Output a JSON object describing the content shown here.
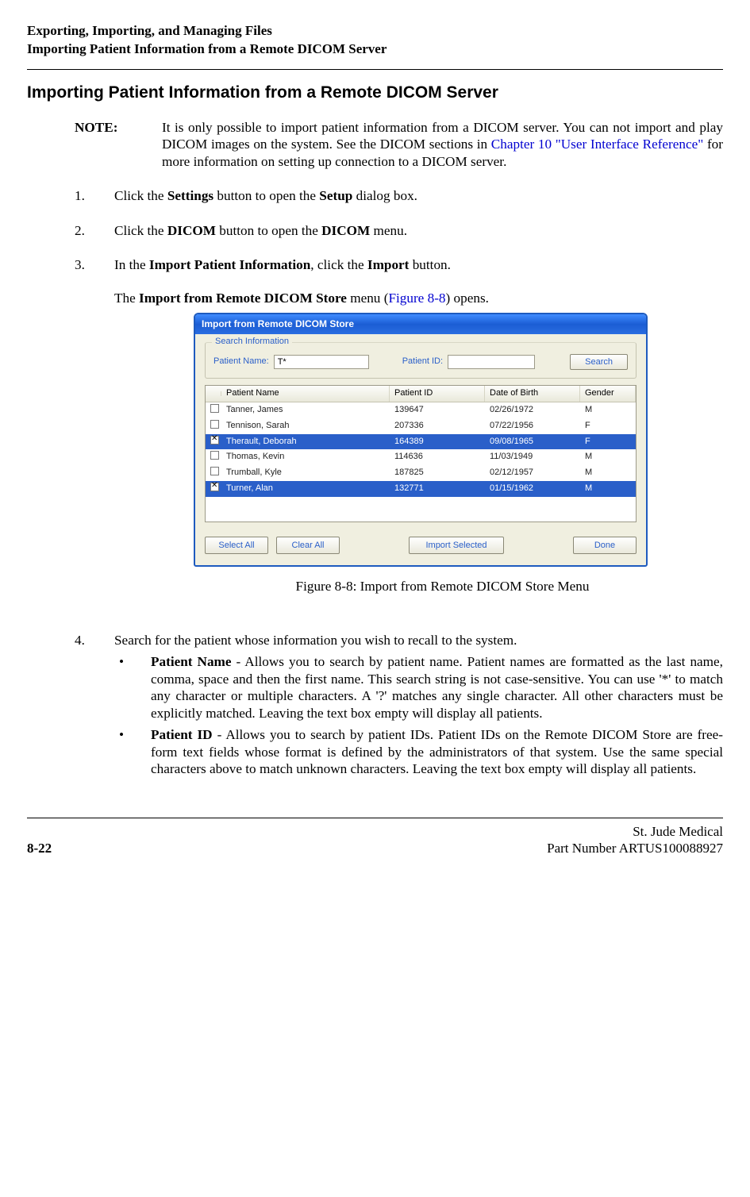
{
  "header": {
    "line1": "Exporting, Importing, and Managing Files",
    "line2": "Importing Patient Information from a Remote DICOM Server"
  },
  "section_title": "Importing Patient Information from a Remote DICOM Server",
  "note": {
    "label": "NOTE:",
    "text_before_link": "It is only possible to import patient information from a DICOM server. You can not import and play DICOM images on the system. See the DICOM sections in ",
    "link_text": "Chapter 10 \"User Interface Reference\"",
    "text_after_link": " for more infor­mation on setting up connection to a DICOM server."
  },
  "steps": {
    "s1": {
      "num": "1.",
      "a": "Click the ",
      "b": "Settings",
      "c": " button to open the ",
      "d": "Setup",
      "e": " dialog box."
    },
    "s2": {
      "num": "2.",
      "a": "Click the ",
      "b": "DICOM",
      "c": " button to open the ",
      "d": "DICOM",
      "e": " menu."
    },
    "s3": {
      "num": "3.",
      "a": "In the ",
      "b": "Import Patient Information",
      "c": ", click the ",
      "d": "Import",
      "e": " button.",
      "p2a": "The ",
      "p2b": "Import from Remote DICOM Store",
      "p2c": " menu (",
      "p2link": "Figure 8-8",
      "p2d": ") opens."
    },
    "s4": {
      "num": "4.",
      "text": "Search for the patient whose information you wish to recall to the system."
    }
  },
  "bullets": {
    "b1": {
      "lead": "Patient Name",
      "rest": " - Allows you to search by patient name. Patient names are for­matted as the last name, comma, space and then the first name. This search string is not case-sensitive. You can use '*' to match any character or multiple characters. A '?' matches any single character. All other characters must be explicitly matched. Leaving the text box empty will display all patients."
    },
    "b2": {
      "lead": "Patient ID",
      "rest": " - Allows you to search by patient IDs. Patient IDs on the Remote DICOM Store are free-form text fields whose format is defined by the admin­istrators of that system. Use the same special characters above to match unknown characters. Leaving the text box empty will display all patients."
    }
  },
  "figure_caption": "Figure 8-8:  Import from Remote DICOM Store Menu",
  "dialog": {
    "title": "Import from Remote DICOM Store",
    "fieldset_label": "Search Information",
    "patient_name_label": "Patient Name:",
    "patient_name_value": "T*",
    "patient_id_label": "Patient ID:",
    "patient_id_value": "",
    "search_btn": "Search",
    "columns": {
      "c1": "Patient Name",
      "c2": "Patient ID",
      "c3": "Date of Birth",
      "c4": "Gender"
    },
    "rows": [
      {
        "checked": false,
        "selected": false,
        "name": "Tanner, James",
        "id": "139647",
        "dob": "02/26/1972",
        "gender": "M"
      },
      {
        "checked": false,
        "selected": false,
        "name": "Tennison, Sarah",
        "id": "207336",
        "dob": "07/22/1956",
        "gender": "F"
      },
      {
        "checked": true,
        "selected": true,
        "name": "Therault, Deborah",
        "id": "164389",
        "dob": "09/08/1965",
        "gender": "F"
      },
      {
        "checked": false,
        "selected": false,
        "name": "Thomas, Kevin",
        "id": "114636",
        "dob": "11/03/1949",
        "gender": "M"
      },
      {
        "checked": false,
        "selected": false,
        "name": "Trumball, Kyle",
        "id": "187825",
        "dob": "02/12/1957",
        "gender": "M"
      },
      {
        "checked": true,
        "selected": true,
        "name": "Turner, Alan",
        "id": "132771",
        "dob": "01/15/1962",
        "gender": "M"
      }
    ],
    "buttons": {
      "select_all": "Select All",
      "clear_all": "Clear All",
      "import_selected": "Import Selected",
      "done": "Done"
    }
  },
  "footer": {
    "page": "8-22",
    "company": "St. Jude Medical",
    "part": "Part Number ARTUS100088927"
  }
}
